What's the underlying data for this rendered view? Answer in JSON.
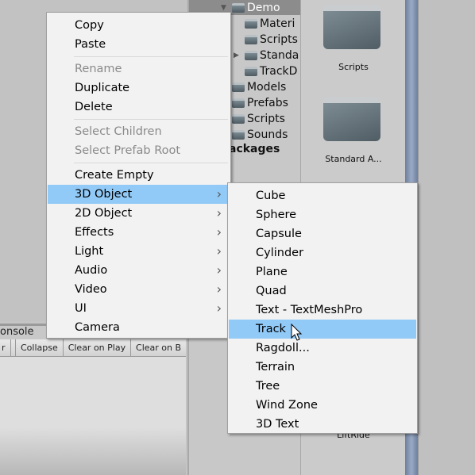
{
  "project_tree": {
    "items": [
      {
        "label": "Demo",
        "indent": 0,
        "expanded": true,
        "selected": true
      },
      {
        "label": "Materi",
        "indent": 1
      },
      {
        "label": "Scripts",
        "indent": 1
      },
      {
        "label": "Standa",
        "indent": 1,
        "collapsed_arrow": true
      },
      {
        "label": "TrackD",
        "indent": 1
      },
      {
        "label": "Models",
        "indent": 0
      },
      {
        "label": "Prefabs",
        "indent": 0
      },
      {
        "label": "Scripts",
        "indent": 0
      },
      {
        "label": "Sounds",
        "indent": 0
      }
    ],
    "packages_label": "ackages"
  },
  "asset_grid": {
    "items": [
      {
        "label": "Scripts"
      },
      {
        "label": "Standard A..."
      },
      {
        "label": "LiftRide"
      }
    ]
  },
  "console": {
    "tab": "onsole",
    "toolbar": [
      "r",
      "Collapse",
      "Clear on Play",
      "Clear on B"
    ]
  },
  "context_menu": {
    "items": [
      {
        "label": "Copy"
      },
      {
        "label": "Paste"
      },
      {
        "sep": true
      },
      {
        "label": "Rename",
        "disabled": true
      },
      {
        "label": "Duplicate"
      },
      {
        "label": "Delete"
      },
      {
        "sep": true
      },
      {
        "label": "Select Children",
        "disabled": true
      },
      {
        "label": "Select Prefab Root",
        "disabled": true
      },
      {
        "sep": true
      },
      {
        "label": "Create Empty"
      },
      {
        "label": "3D Object",
        "submenu": true,
        "highlighted": true
      },
      {
        "label": "2D Object",
        "submenu": true
      },
      {
        "label": "Effects",
        "submenu": true
      },
      {
        "label": "Light",
        "submenu": true
      },
      {
        "label": "Audio",
        "submenu": true
      },
      {
        "label": "Video",
        "submenu": true
      },
      {
        "label": "UI",
        "submenu": true
      },
      {
        "label": "Camera"
      }
    ]
  },
  "submenu": {
    "items": [
      {
        "label": "Cube"
      },
      {
        "label": "Sphere"
      },
      {
        "label": "Capsule"
      },
      {
        "label": "Cylinder"
      },
      {
        "label": "Plane"
      },
      {
        "label": "Quad"
      },
      {
        "label": "Text - TextMeshPro"
      },
      {
        "label": "Track",
        "highlighted": true
      },
      {
        "label": "Ragdoll..."
      },
      {
        "label": "Terrain"
      },
      {
        "label": "Tree"
      },
      {
        "label": "Wind Zone"
      },
      {
        "label": "3D Text"
      }
    ]
  },
  "colors": {
    "highlight": "#91c9f7",
    "menu_bg": "#f2f2f2",
    "disabled": "#8a8a8a"
  }
}
